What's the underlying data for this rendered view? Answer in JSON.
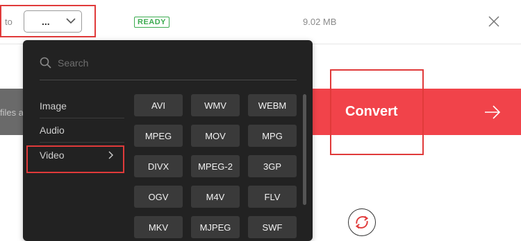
{
  "file_row": {
    "to_label": "to",
    "selected_format": "...",
    "status": "READY",
    "size": "9.02 MB"
  },
  "background": {
    "files_hint": "files a",
    "convert_label": "Convert"
  },
  "dropdown": {
    "search_placeholder": "Search",
    "categories": [
      {
        "label": "Image"
      },
      {
        "label": "Audio"
      },
      {
        "label": "Video"
      }
    ],
    "active_category": "Video",
    "formats": [
      "AVI",
      "WMV",
      "WEBM",
      "MPEG",
      "MOV",
      "MPG",
      "DIVX",
      "MPEG-2",
      "3GP",
      "OGV",
      "M4V",
      "FLV",
      "MKV",
      "MJPEG",
      "SWF"
    ]
  },
  "colors": {
    "accent_red": "#f1434a",
    "ready_green": "#3bab4f",
    "dropdown_bg": "#222222",
    "format_button_bg": "#3a3a3a"
  }
}
